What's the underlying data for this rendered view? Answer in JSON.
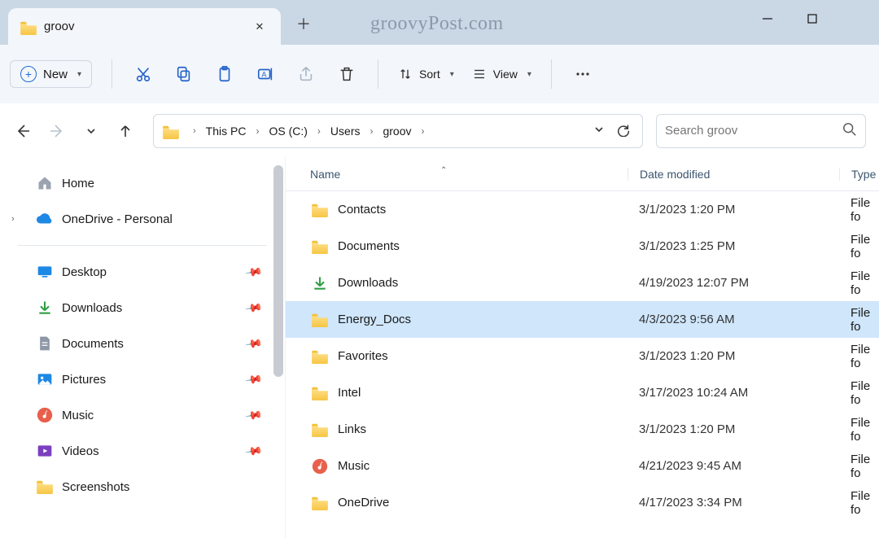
{
  "tab": {
    "title": "groov"
  },
  "watermark": "groovyPost.com",
  "toolbar": {
    "new_label": "New",
    "sort_label": "Sort",
    "view_label": "View"
  },
  "breadcrumbs": [
    "This PC",
    "OS (C:)",
    "Users",
    "groov"
  ],
  "search": {
    "placeholder": "Search groov"
  },
  "sidebar": {
    "top": [
      {
        "label": "Home",
        "icon": "home-icon"
      },
      {
        "label": "OneDrive - Personal",
        "icon": "onedrive-icon",
        "expandable": true
      }
    ],
    "quick": [
      {
        "label": "Desktop",
        "icon": "desktop-icon",
        "pinned": true
      },
      {
        "label": "Downloads",
        "icon": "downloads-icon",
        "pinned": true
      },
      {
        "label": "Documents",
        "icon": "documents-icon",
        "pinned": true
      },
      {
        "label": "Pictures",
        "icon": "pictures-icon",
        "pinned": true
      },
      {
        "label": "Music",
        "icon": "music-icon",
        "pinned": true
      },
      {
        "label": "Videos",
        "icon": "videos-icon",
        "pinned": true
      },
      {
        "label": "Screenshots",
        "icon": "folder-icon",
        "pinned": false
      }
    ]
  },
  "columns": {
    "name": "Name",
    "date": "Date modified",
    "type": "Type"
  },
  "rows": [
    {
      "name": "Contacts",
      "date": "3/1/2023 1:20 PM",
      "type": "File fo",
      "icon": "folder",
      "selected": false
    },
    {
      "name": "Documents",
      "date": "3/1/2023 1:25 PM",
      "type": "File fo",
      "icon": "folder",
      "selected": false
    },
    {
      "name": "Downloads",
      "date": "4/19/2023 12:07 PM",
      "type": "File fo",
      "icon": "downloads",
      "selected": false
    },
    {
      "name": "Energy_Docs",
      "date": "4/3/2023 9:56 AM",
      "type": "File fo",
      "icon": "folder",
      "selected": true
    },
    {
      "name": "Favorites",
      "date": "3/1/2023 1:20 PM",
      "type": "File fo",
      "icon": "folder",
      "selected": false
    },
    {
      "name": "Intel",
      "date": "3/17/2023 10:24 AM",
      "type": "File fo",
      "icon": "folder",
      "selected": false
    },
    {
      "name": "Links",
      "date": "3/1/2023 1:20 PM",
      "type": "File fo",
      "icon": "folder",
      "selected": false
    },
    {
      "name": "Music",
      "date": "4/21/2023 9:45 AM",
      "type": "File fo",
      "icon": "music",
      "selected": false
    },
    {
      "name": "OneDrive",
      "date": "4/17/2023 3:34 PM",
      "type": "File fo",
      "icon": "folder",
      "selected": false
    }
  ]
}
